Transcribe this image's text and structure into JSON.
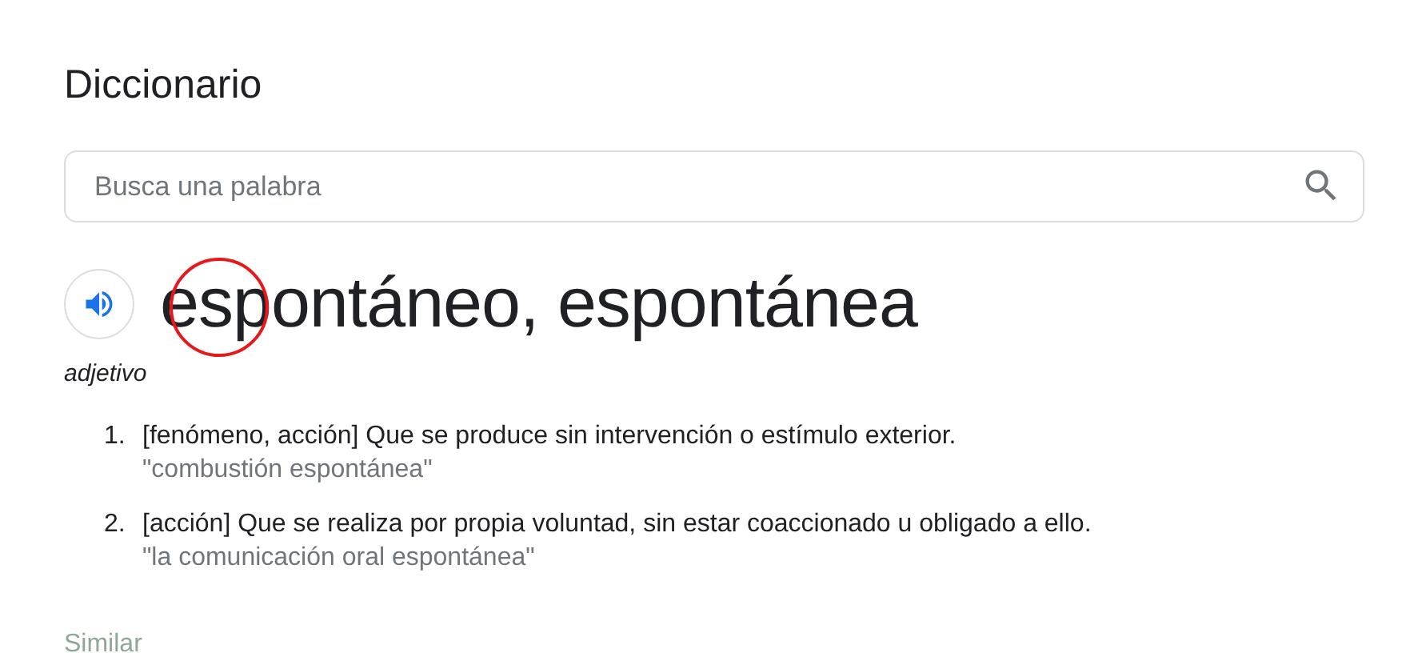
{
  "title": "Diccionario",
  "search": {
    "placeholder": "Busca una palabra"
  },
  "entry": {
    "headword": "espontáneo, espontánea",
    "highlight_circle": true,
    "part_of_speech": "adjetivo",
    "senses": [
      {
        "number": "1.",
        "labels": "[fenómeno, acción]",
        "definition": "Que se produce sin intervención o estímulo exterior.",
        "example": "\"combustión espontánea\""
      },
      {
        "number": "2.",
        "labels": "[acción]",
        "definition": "Que se realiza por propia voluntad, sin estar coaccionado u obligado a ello.",
        "example": "\"la comunicación oral espontánea\""
      }
    ]
  },
  "section_heading": "Similar"
}
